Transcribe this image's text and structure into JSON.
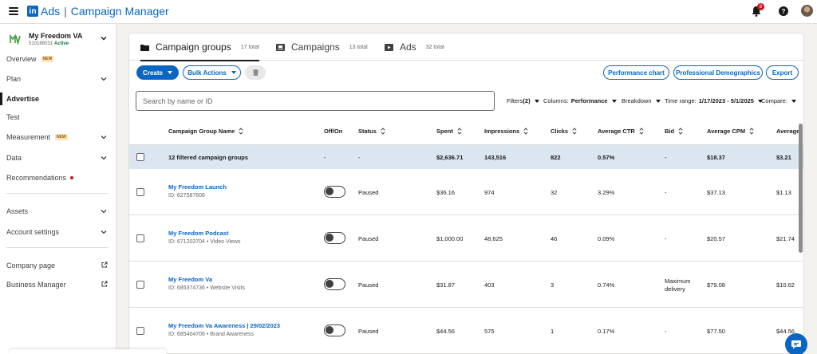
{
  "app": {
    "brand_ads": "Ads",
    "brand_product": "Campaign Manager",
    "notifications_count": "8",
    "help_label": "?"
  },
  "account": {
    "name": "My Freedom VA",
    "id": "510188031",
    "status": "Active"
  },
  "sidebar": {
    "items": [
      {
        "label": "Overview",
        "badge": "NEW"
      },
      {
        "label": "Plan"
      },
      {
        "label": "Advertise"
      },
      {
        "label": "Test"
      },
      {
        "label": "Measurement",
        "badge": "NEW"
      },
      {
        "label": "Data"
      },
      {
        "label": "Recommendations"
      },
      {
        "label": "Assets"
      },
      {
        "label": "Account settings"
      },
      {
        "label": "Company page"
      },
      {
        "label": "Business Manager"
      }
    ]
  },
  "tabs": [
    {
      "label": "Campaign groups",
      "count": "17 total"
    },
    {
      "label": "Campaigns",
      "count": "13 total"
    },
    {
      "label": "Ads",
      "count": "32 total"
    }
  ],
  "toolbar": {
    "create": "Create",
    "bulk_actions": "Bulk Actions",
    "performance_chart": "Performance chart",
    "professional_demographics": "Professional Demographics",
    "export": "Export"
  },
  "search": {
    "placeholder": "Search by name or ID"
  },
  "filters": {
    "filters_label": "Filters",
    "filters_count": "(2)",
    "columns_label": "Columns:",
    "columns_value": "Performance",
    "breakdown_label": "Breakdown",
    "time_range_label": "Time range:",
    "time_range_value": "1/17/2023 - 5/1/2025",
    "compare_label": "Compare:"
  },
  "table": {
    "headers": [
      "Campaign Group Name",
      "Off/On",
      "Status",
      "Spent",
      "Impressions",
      "Clicks",
      "Average CTR",
      "Bid",
      "Average CPM",
      "Average"
    ],
    "summary": {
      "label": "12 filtered campaign groups",
      "offon": "-",
      "status": "-",
      "spent": "$2,636.71",
      "impressions": "143,516",
      "clicks": "822",
      "ctr": "0.57%",
      "bid": "-",
      "cpm": "$18.37",
      "avg": "$3.21"
    },
    "rows": [
      {
        "name": "My Freedom Launch",
        "sub": "ID: 627587606",
        "status": "Paused",
        "spent": "$36.16",
        "impressions": "974",
        "clicks": "32",
        "ctr": "3.29%",
        "bid": "-",
        "cpm": "$37.13",
        "avg": "$1.13"
      },
      {
        "name": "My Freedom Podcast",
        "sub": "ID: 671203704 • Video Views",
        "status": "Paused",
        "spent": "$1,000.00",
        "impressions": "48,625",
        "clicks": "46",
        "ctr": "0.09%",
        "bid": "-",
        "cpm": "$20.57",
        "avg": "$21.74"
      },
      {
        "name": "My Freedom Va",
        "sub": "ID: 685374736 • Website Visits",
        "status": "Paused",
        "spent": "$31.87",
        "impressions": "403",
        "clicks": "3",
        "ctr": "0.74%",
        "bid_line1": "Maximum",
        "bid_line2": "delivery",
        "cpm": "$79.08",
        "avg": "$10.62"
      },
      {
        "name": "My Freedom Va Awareness | 29/02/2023",
        "sub": "ID: 685404706 • Brand Awareness",
        "status": "Paused",
        "spent": "$44.56",
        "impressions": "575",
        "clicks": "1",
        "ctr": "0.17%",
        "bid": "-",
        "cpm": "$77.50",
        "avg": "$44.56"
      }
    ]
  },
  "colors": {
    "accent": "#0a66c2",
    "summary_bg": "#dce6f1",
    "badge_new_bg": "#fce2ba",
    "notification": "#cc1016",
    "active_status": "#057642"
  }
}
